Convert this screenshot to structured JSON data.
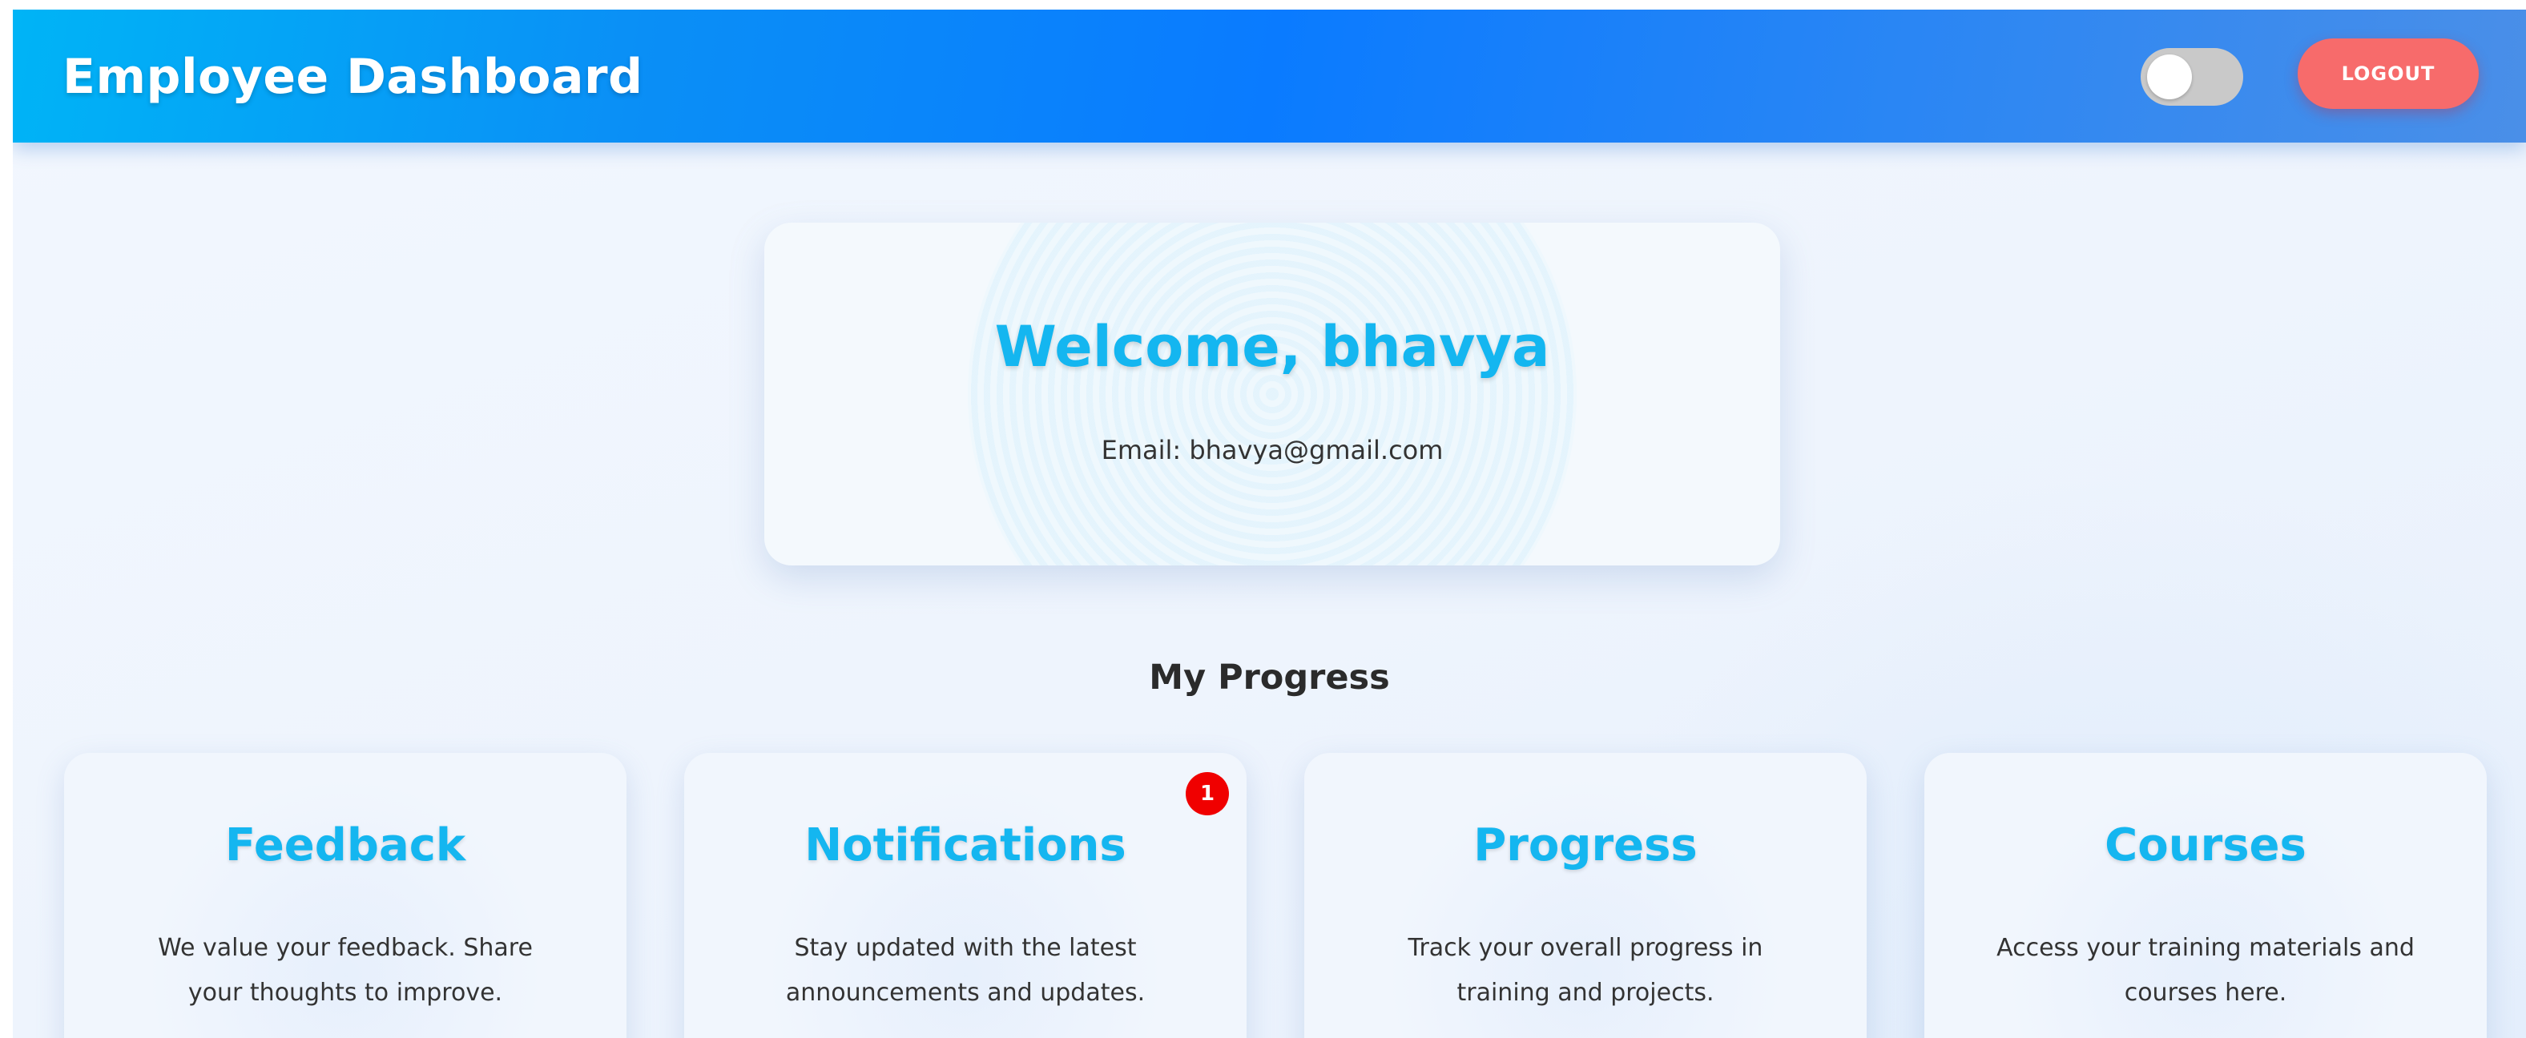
{
  "header": {
    "title": "Employee Dashboard",
    "theme_toggle": {
      "state": "off"
    },
    "logout_label": "LOGOUT"
  },
  "welcome": {
    "title": "Welcome, bhavya",
    "email": "Email: bhavya@gmail.com"
  },
  "progress_section": {
    "heading": "My Progress"
  },
  "cards": [
    {
      "title": "Feedback",
      "description": "We value your feedback. Share your thoughts to improve."
    },
    {
      "title": "Notifications",
      "description": "Stay updated with the latest announcements and updates.",
      "badge_count": "1"
    },
    {
      "title": "Progress",
      "description": "Track your overall progress in training and projects."
    },
    {
      "title": "Courses",
      "description": "Access your training materials and courses here."
    }
  ],
  "colors": {
    "header_gradient_start": "#00b4f6",
    "header_gradient_end": "#4a8fe8",
    "accent_title": "#14b6f0",
    "logout_button": "#f76b6b",
    "badge": "#f00000",
    "toggle_track": "#c9c9c9"
  }
}
